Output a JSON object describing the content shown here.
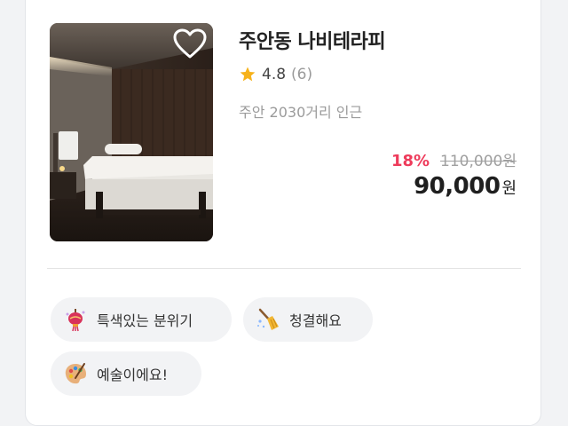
{
  "listing": {
    "name": "주안동 나비테라피",
    "rating": "4.8",
    "review_count": "(6)",
    "location": "주안 2030거리 인근",
    "discount": "18%",
    "original_price": "110,000원",
    "price": "90,000",
    "currency": "원",
    "favorited": false
  },
  "tags": [
    {
      "label": "특색있는 분위기",
      "icon": "lantern-icon"
    },
    {
      "label": "청결해요",
      "icon": "broom-icon"
    },
    {
      "label": "예술이에요!",
      "icon": "palette-icon"
    }
  ],
  "colors": {
    "discount": "#ee3b5b",
    "star": "#f6b21a",
    "chip_bg": "#f2f3f5"
  }
}
